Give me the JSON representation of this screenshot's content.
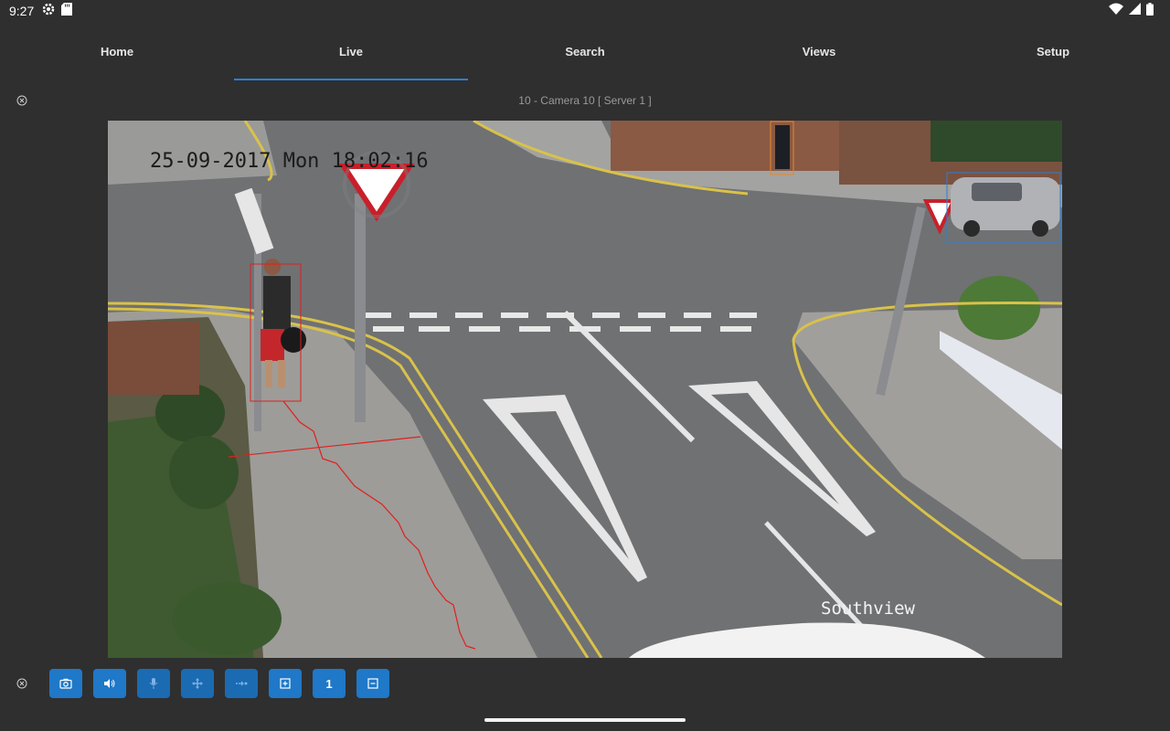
{
  "status": {
    "time": "9:27"
  },
  "nav": {
    "tabs": [
      {
        "label": "Home"
      },
      {
        "label": "Live"
      },
      {
        "label": "Search"
      },
      {
        "label": "Views"
      },
      {
        "label": "Setup"
      }
    ],
    "active_tab": "Live"
  },
  "camera": {
    "title": "10 - Camera 10 [ Server 1 ]",
    "osd_timestamp": "25-09-2017 Mon 18:02:16",
    "osd_location": "Southview"
  },
  "toolbar": {
    "buttons": [
      {
        "icon": "camera-icon"
      },
      {
        "icon": "speaker-icon"
      },
      {
        "icon": "microphone-icon"
      },
      {
        "icon": "ptz-move-icon"
      },
      {
        "icon": "track-icon"
      },
      {
        "icon": "zoom-in-icon"
      },
      {
        "label": "1"
      },
      {
        "icon": "zoom-out-icon"
      }
    ]
  },
  "colors": {
    "accent": "#2b7fd8",
    "button": "#1f78c8",
    "background": "#2f2f2f"
  }
}
